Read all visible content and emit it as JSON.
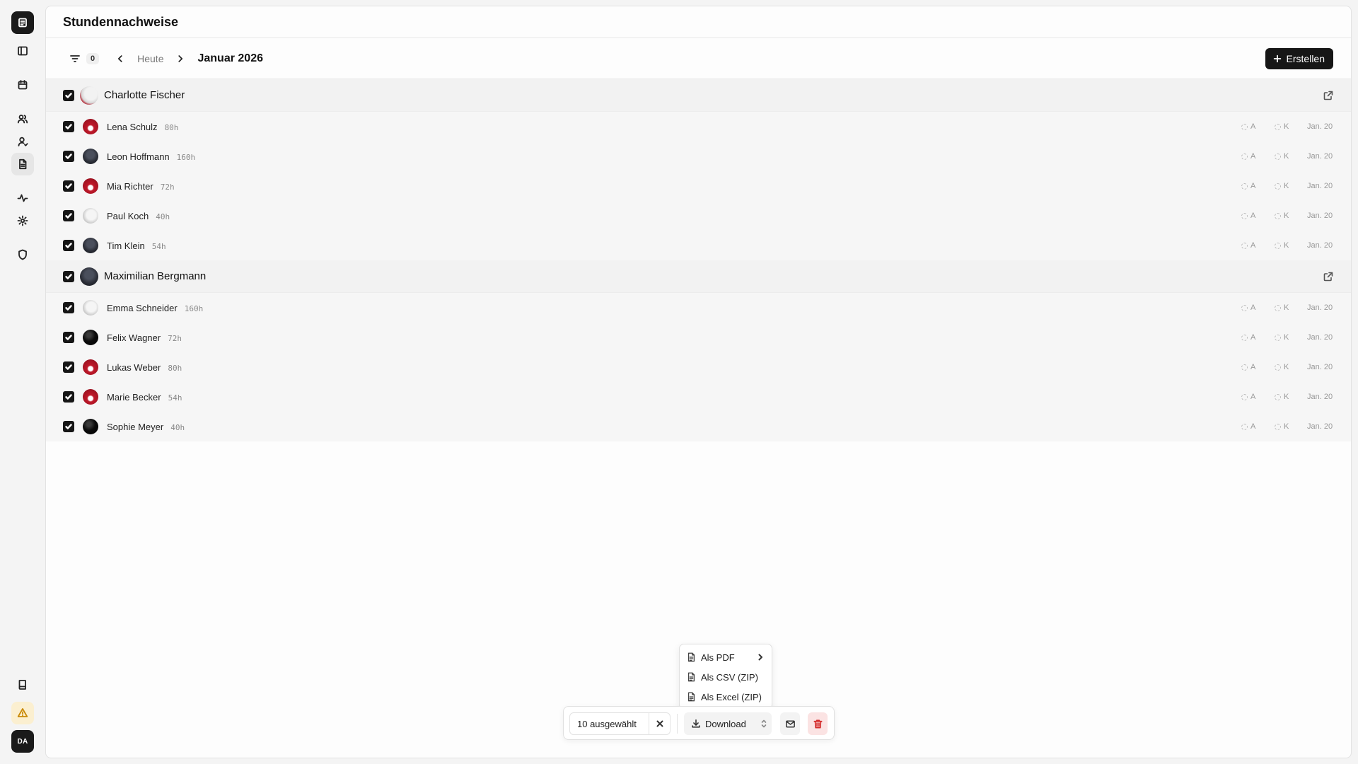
{
  "page": {
    "title": "Stundennachweise"
  },
  "sidebar": {
    "user_initials": "DA"
  },
  "toolbar": {
    "filter_count": "0",
    "today_label": "Heute",
    "month_label": "Januar 2026",
    "create_label": "Erstellen"
  },
  "groups": [
    {
      "name": "Charlotte Fischer",
      "members": [
        {
          "name": "Lena Schulz",
          "hours": "80h",
          "status_a": "A",
          "status_k": "K",
          "date": "Jan. 20"
        },
        {
          "name": "Leon Hoffmann",
          "hours": "160h",
          "status_a": "A",
          "status_k": "K",
          "date": "Jan. 20"
        },
        {
          "name": "Mia Richter",
          "hours": "72h",
          "status_a": "A",
          "status_k": "K",
          "date": "Jan. 20"
        },
        {
          "name": "Paul Koch",
          "hours": "40h",
          "status_a": "A",
          "status_k": "K",
          "date": "Jan. 20"
        },
        {
          "name": "Tim Klein",
          "hours": "54h",
          "status_a": "A",
          "status_k": "K",
          "date": "Jan. 20"
        }
      ]
    },
    {
      "name": "Maximilian Bergmann",
      "members": [
        {
          "name": "Emma Schneider",
          "hours": "160h",
          "status_a": "A",
          "status_k": "K",
          "date": "Jan. 20"
        },
        {
          "name": "Felix Wagner",
          "hours": "72h",
          "status_a": "A",
          "status_k": "K",
          "date": "Jan. 20"
        },
        {
          "name": "Lukas Weber",
          "hours": "80h",
          "status_a": "A",
          "status_k": "K",
          "date": "Jan. 20"
        },
        {
          "name": "Marie Becker",
          "hours": "54h",
          "status_a": "A",
          "status_k": "K",
          "date": "Jan. 20"
        },
        {
          "name": "Sophie Meyer",
          "hours": "40h",
          "status_a": "A",
          "status_k": "K",
          "date": "Jan. 20"
        }
      ]
    }
  ],
  "action_bar": {
    "selected_label": "10 ausgewählt",
    "download_label": "Download"
  },
  "download_menu": {
    "items": [
      {
        "label": "Als PDF"
      },
      {
        "label": "Als CSV (ZIP)"
      },
      {
        "label": "Als Excel (ZIP)"
      }
    ]
  },
  "colors": {
    "accent_dark": "#161616",
    "danger": "#d42a2a",
    "warning": "#c98a08"
  }
}
